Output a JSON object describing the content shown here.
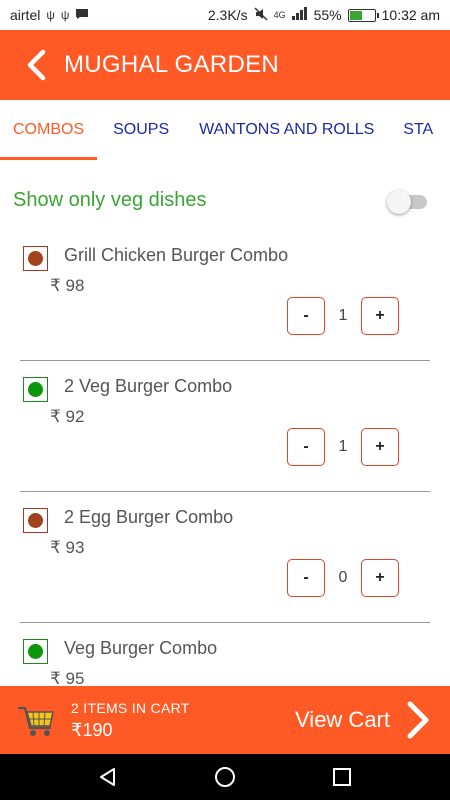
{
  "status_bar": {
    "carrier": "airtel",
    "network_speed": "2.3K/s",
    "network_type": "4G",
    "battery_percent": "55%",
    "battery_level": 0.55,
    "time": "10:32 am"
  },
  "app_bar": {
    "title": "MUGHAL GARDEN",
    "background_color": "#ff5a25"
  },
  "tabs": [
    {
      "label": "COMBOS",
      "active": true
    },
    {
      "label": "SOUPS",
      "active": false
    },
    {
      "label": "WANTONS AND ROLLS",
      "active": false
    },
    {
      "label": "STA",
      "active": false
    }
  ],
  "veg_filter": {
    "label": "Show only veg dishes",
    "enabled": false
  },
  "currency_symbol": "₹",
  "items": [
    {
      "name": "Grill Chicken Burger Combo",
      "price": "₹ 98",
      "diet": "non-veg",
      "qty": "1",
      "minus": "-",
      "plus": "+"
    },
    {
      "name": "2 Veg Burger Combo",
      "price": "₹ 92",
      "diet": "veg",
      "qty": "1",
      "minus": "-",
      "plus": "+"
    },
    {
      "name": "2 Egg Burger Combo",
      "price": "₹ 93",
      "diet": "non-veg",
      "qty": "0",
      "minus": "-",
      "plus": "+"
    },
    {
      "name": "Veg Burger Combo",
      "price": "₹ 95",
      "diet": "veg",
      "qty": "",
      "minus": "-",
      "plus": "+"
    }
  ],
  "cart": {
    "count_label": "2 ITEMS IN CART",
    "total": "₹190",
    "action_label": "View Cart",
    "icon": "cart-icon"
  },
  "colors": {
    "accent": "#ff5a25",
    "tab_text": "#1a2aa6",
    "veg_green": "#3aa435",
    "nonveg_brown": "#a3421f"
  }
}
